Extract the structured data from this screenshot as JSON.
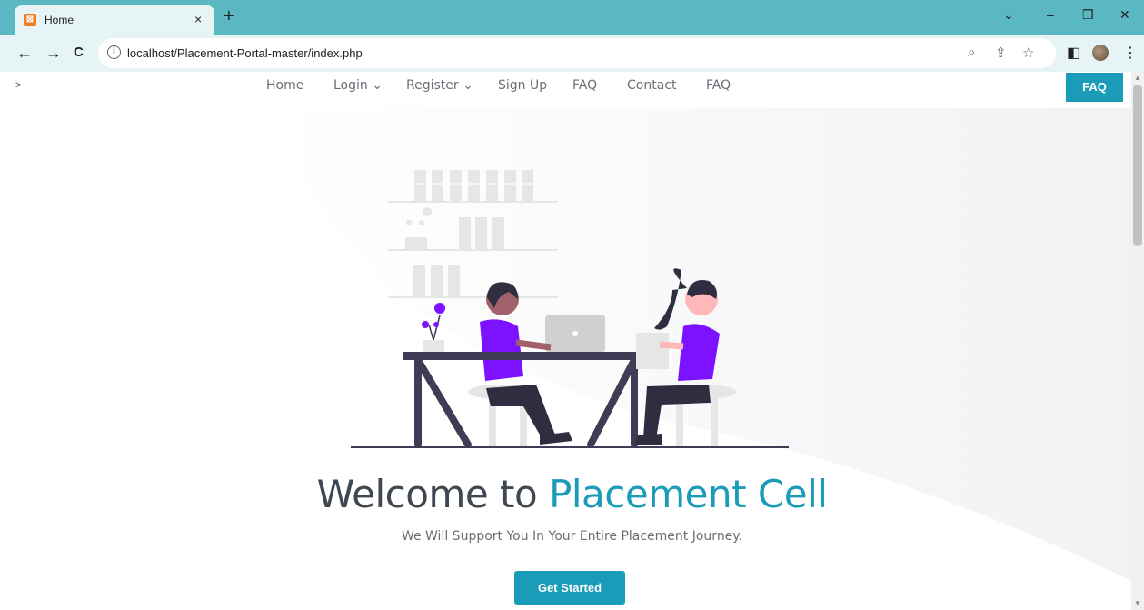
{
  "browser": {
    "tab_title": "Home",
    "tab_close": "×",
    "new_tab": "+",
    "url": "localhost/Placement-Portal-master/index.php",
    "window_controls": {
      "dropdown": "⌄",
      "minimize": "–",
      "restore": "❐",
      "close": "✕"
    },
    "nav": {
      "back": "←",
      "forward": "→",
      "reload": "C"
    },
    "icons": {
      "zoom": "⌕",
      "share": "⇪",
      "star": "☆",
      "sidepanel": "◧",
      "menu": "⋮",
      "info": "i"
    }
  },
  "page": {
    "caret": ">",
    "nav_items": [
      "Home",
      "Login ⌄",
      "Register ⌄",
      "Sign Up",
      "FAQ",
      "Contact",
      "FAQ"
    ],
    "faq_button": "FAQ",
    "headline_prefix": "Welcome to ",
    "headline_accent": "Placement Cell",
    "subheadline": "We Will Support You In Your Entire Placement Journey.",
    "cta_label": "Get Started"
  },
  "colors": {
    "accent": "#1a9bb8",
    "tab_strip": "#5ab8c3",
    "toolbar": "#e6f4f6",
    "illustration_purple": "#7c12ff",
    "illustration_dark": "#3f3d56"
  }
}
